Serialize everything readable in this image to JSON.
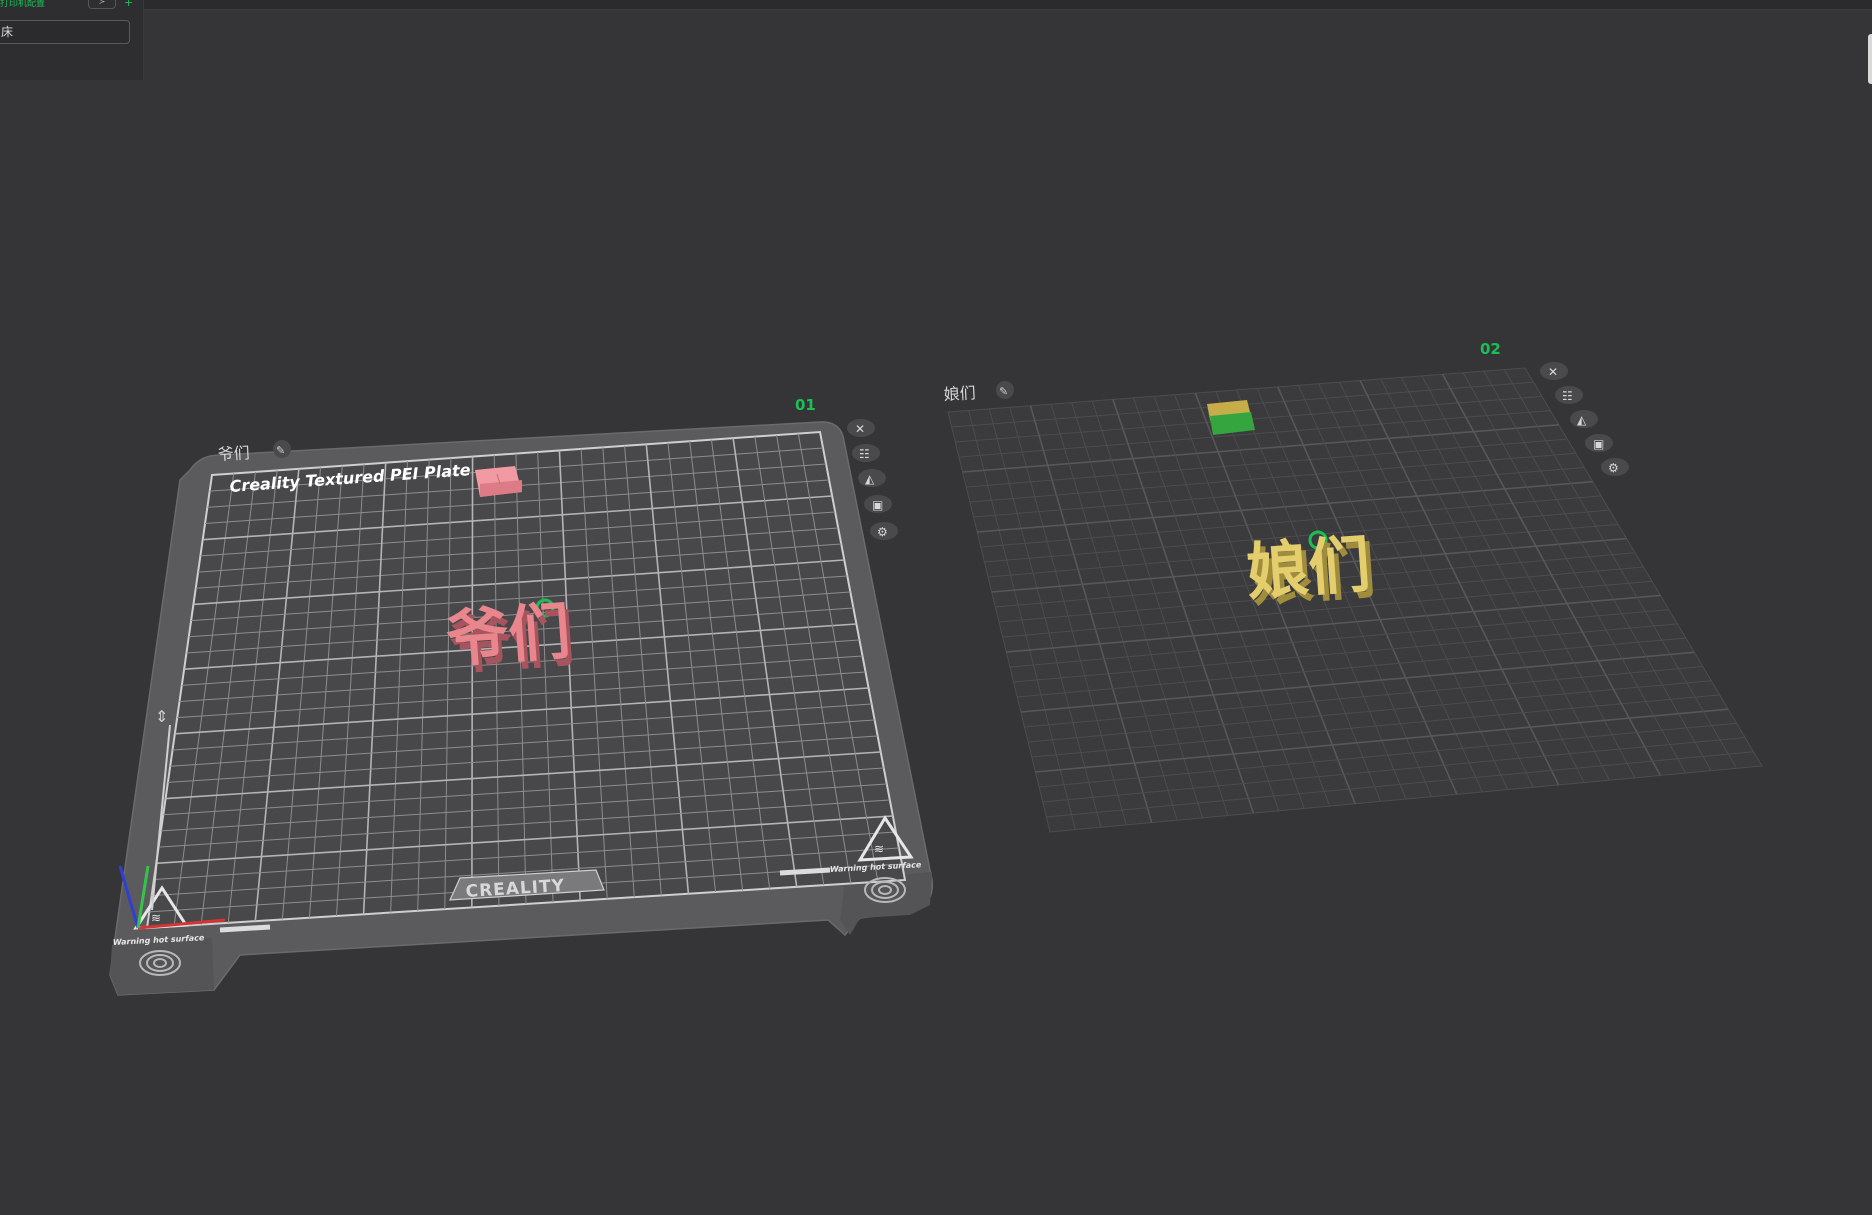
{
  "top_bar": {
    "tab_name": "打印机配置",
    "tab_button": "≻",
    "tab_add": "+"
  },
  "objects_panel": {
    "search_value": "床"
  },
  "plates": [
    {
      "name": "爷们",
      "index": "01",
      "bed_title": "Creality Textured PEI Plate",
      "bed_brand": "CREALITY",
      "warning_left": "Warning hot surface",
      "warning_right": "Warning hot surface",
      "model_text": "爷们",
      "model_color": "#e8858d",
      "wipe_tower_color": "#f29aa3"
    },
    {
      "name": "娘们",
      "index": "02",
      "model_text": "娘们",
      "model_color": "#e3cd6c",
      "wipe_tower_color_top": "#c7ac4a",
      "wipe_tower_color_side": "#35a63f"
    }
  ],
  "plate_tool_icons": [
    "close-icon",
    "arrange-icon",
    "orient-icon",
    "lock-icon",
    "settings-icon"
  ],
  "colors": {
    "background": "#353537",
    "accent_green": "#19c155",
    "bed_frame": "#5b5b5d",
    "bed_surface": "#48484a",
    "grid_line": "#a9a9a9"
  }
}
